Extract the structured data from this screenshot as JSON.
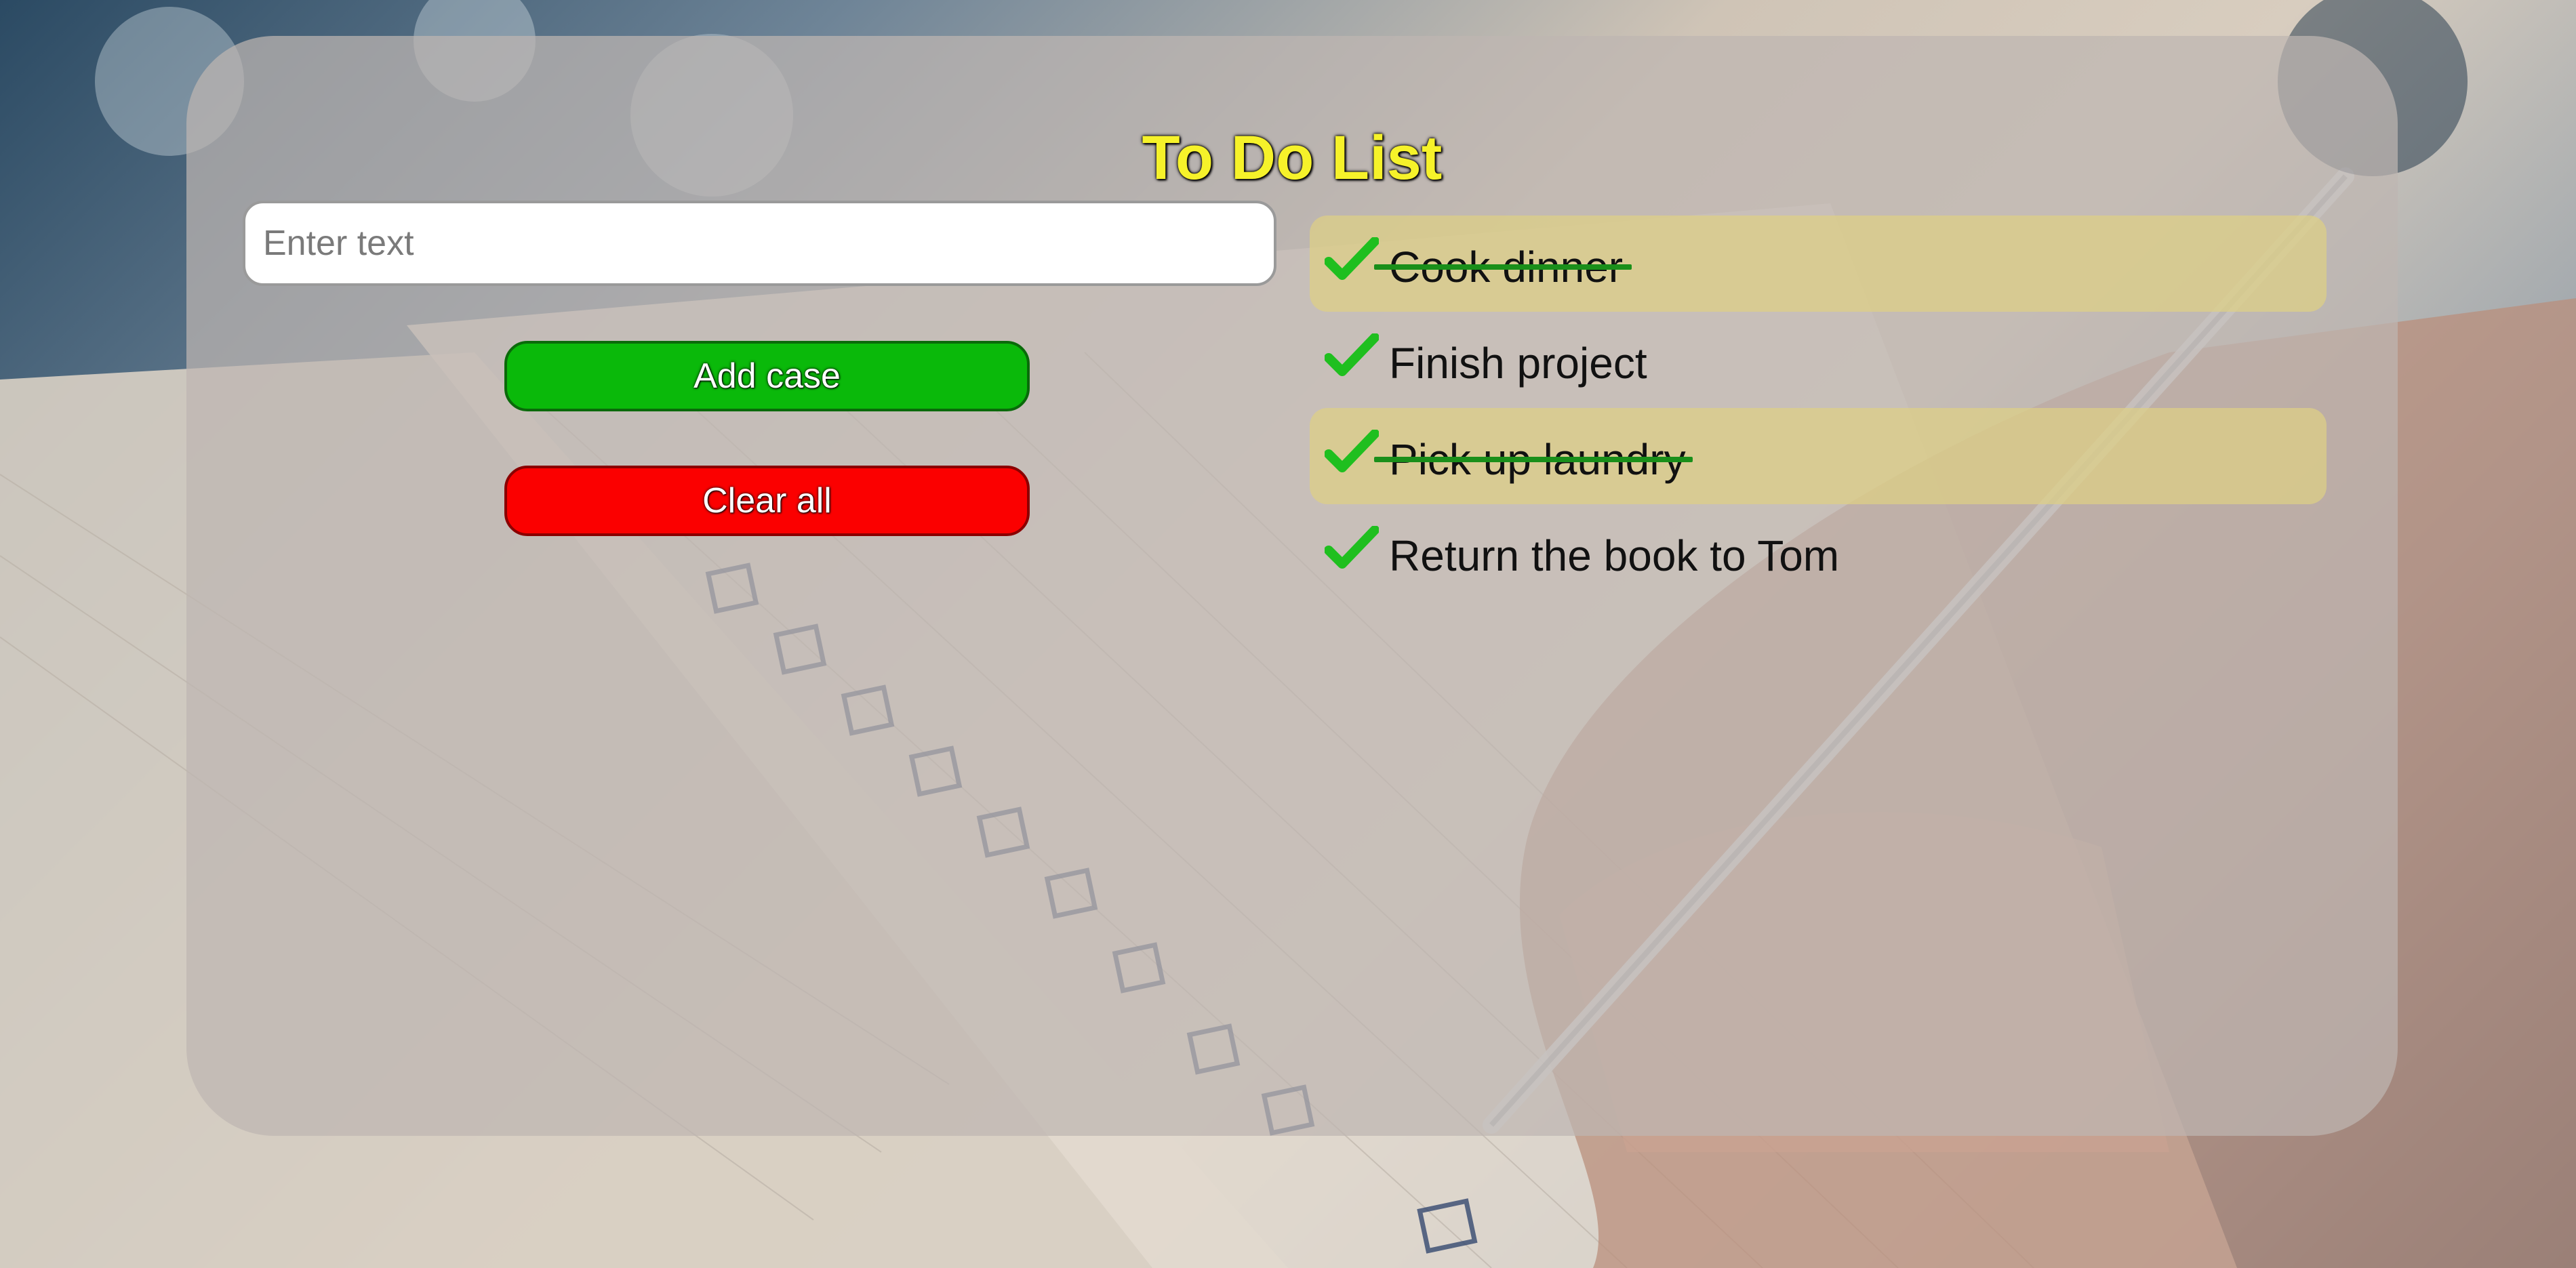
{
  "app": {
    "title": "To Do List"
  },
  "input": {
    "placeholder": "Enter text",
    "value": ""
  },
  "buttons": {
    "add_label": "Add case",
    "clear_label": "Clear all"
  },
  "todos": [
    {
      "label": "Cook dinner",
      "done": true
    },
    {
      "label": "Finish project",
      "done": false
    },
    {
      "label": "Pick up laundry",
      "done": true
    },
    {
      "label": "Return the book to Tom",
      "done": false
    }
  ],
  "colors": {
    "title": "#f6f22a",
    "add_button": "#0ab90a",
    "clear_button": "#fb0000",
    "check": "#1fbf1f",
    "done_highlight": "#ded084"
  },
  "icons": {
    "check": "check-icon"
  }
}
